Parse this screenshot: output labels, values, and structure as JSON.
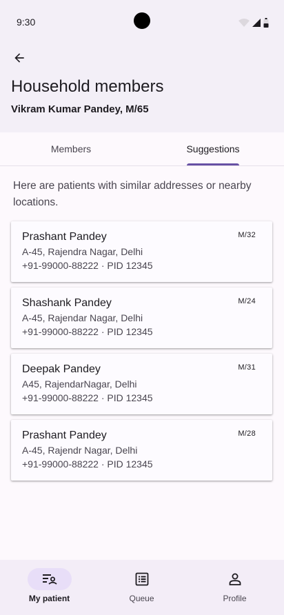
{
  "status_bar": {
    "time": "9:30"
  },
  "header": {
    "title": "Household members",
    "patient": "Vikram Kumar Pandey, M/65"
  },
  "tabs": [
    {
      "label": "Members",
      "active": false
    },
    {
      "label": "Suggestions",
      "active": true
    }
  ],
  "intro": "Here are patients with similar addresses or nearby locations.",
  "suggestions": [
    {
      "name": "Prashant Pandey",
      "meta": "M/32",
      "address": "A-45, Rajendra Nagar, Delhi",
      "contact": "+91-99000-88222 · PID 12345"
    },
    {
      "name": "Shashank Pandey",
      "meta": "M/24",
      "address": "A-45, Rajendar Nagar, Delhi",
      "contact": "+91-99000-88222 · PID 12345"
    },
    {
      "name": "Deepak Pandey",
      "meta": "M/31",
      "address": "A45, RajendarNagar, Delhi",
      "contact": "+91-99000-88222 · PID 12345"
    },
    {
      "name": "Prashant Pandey",
      "meta": "M/28",
      "address": "A-45, Rajendr Nagar, Delhi",
      "contact": "+91-99000-88222 · PID 12345"
    }
  ],
  "bottom_nav": [
    {
      "label": "My patient",
      "icon": "patient-list-icon",
      "active": true
    },
    {
      "label": "Queue",
      "icon": "queue-icon",
      "active": false
    },
    {
      "label": "Profile",
      "icon": "person-icon",
      "active": false
    }
  ],
  "colors": {
    "accent": "#6750a4",
    "header_bg": "#f3eff7",
    "nav_active_pill": "#e8def8"
  }
}
